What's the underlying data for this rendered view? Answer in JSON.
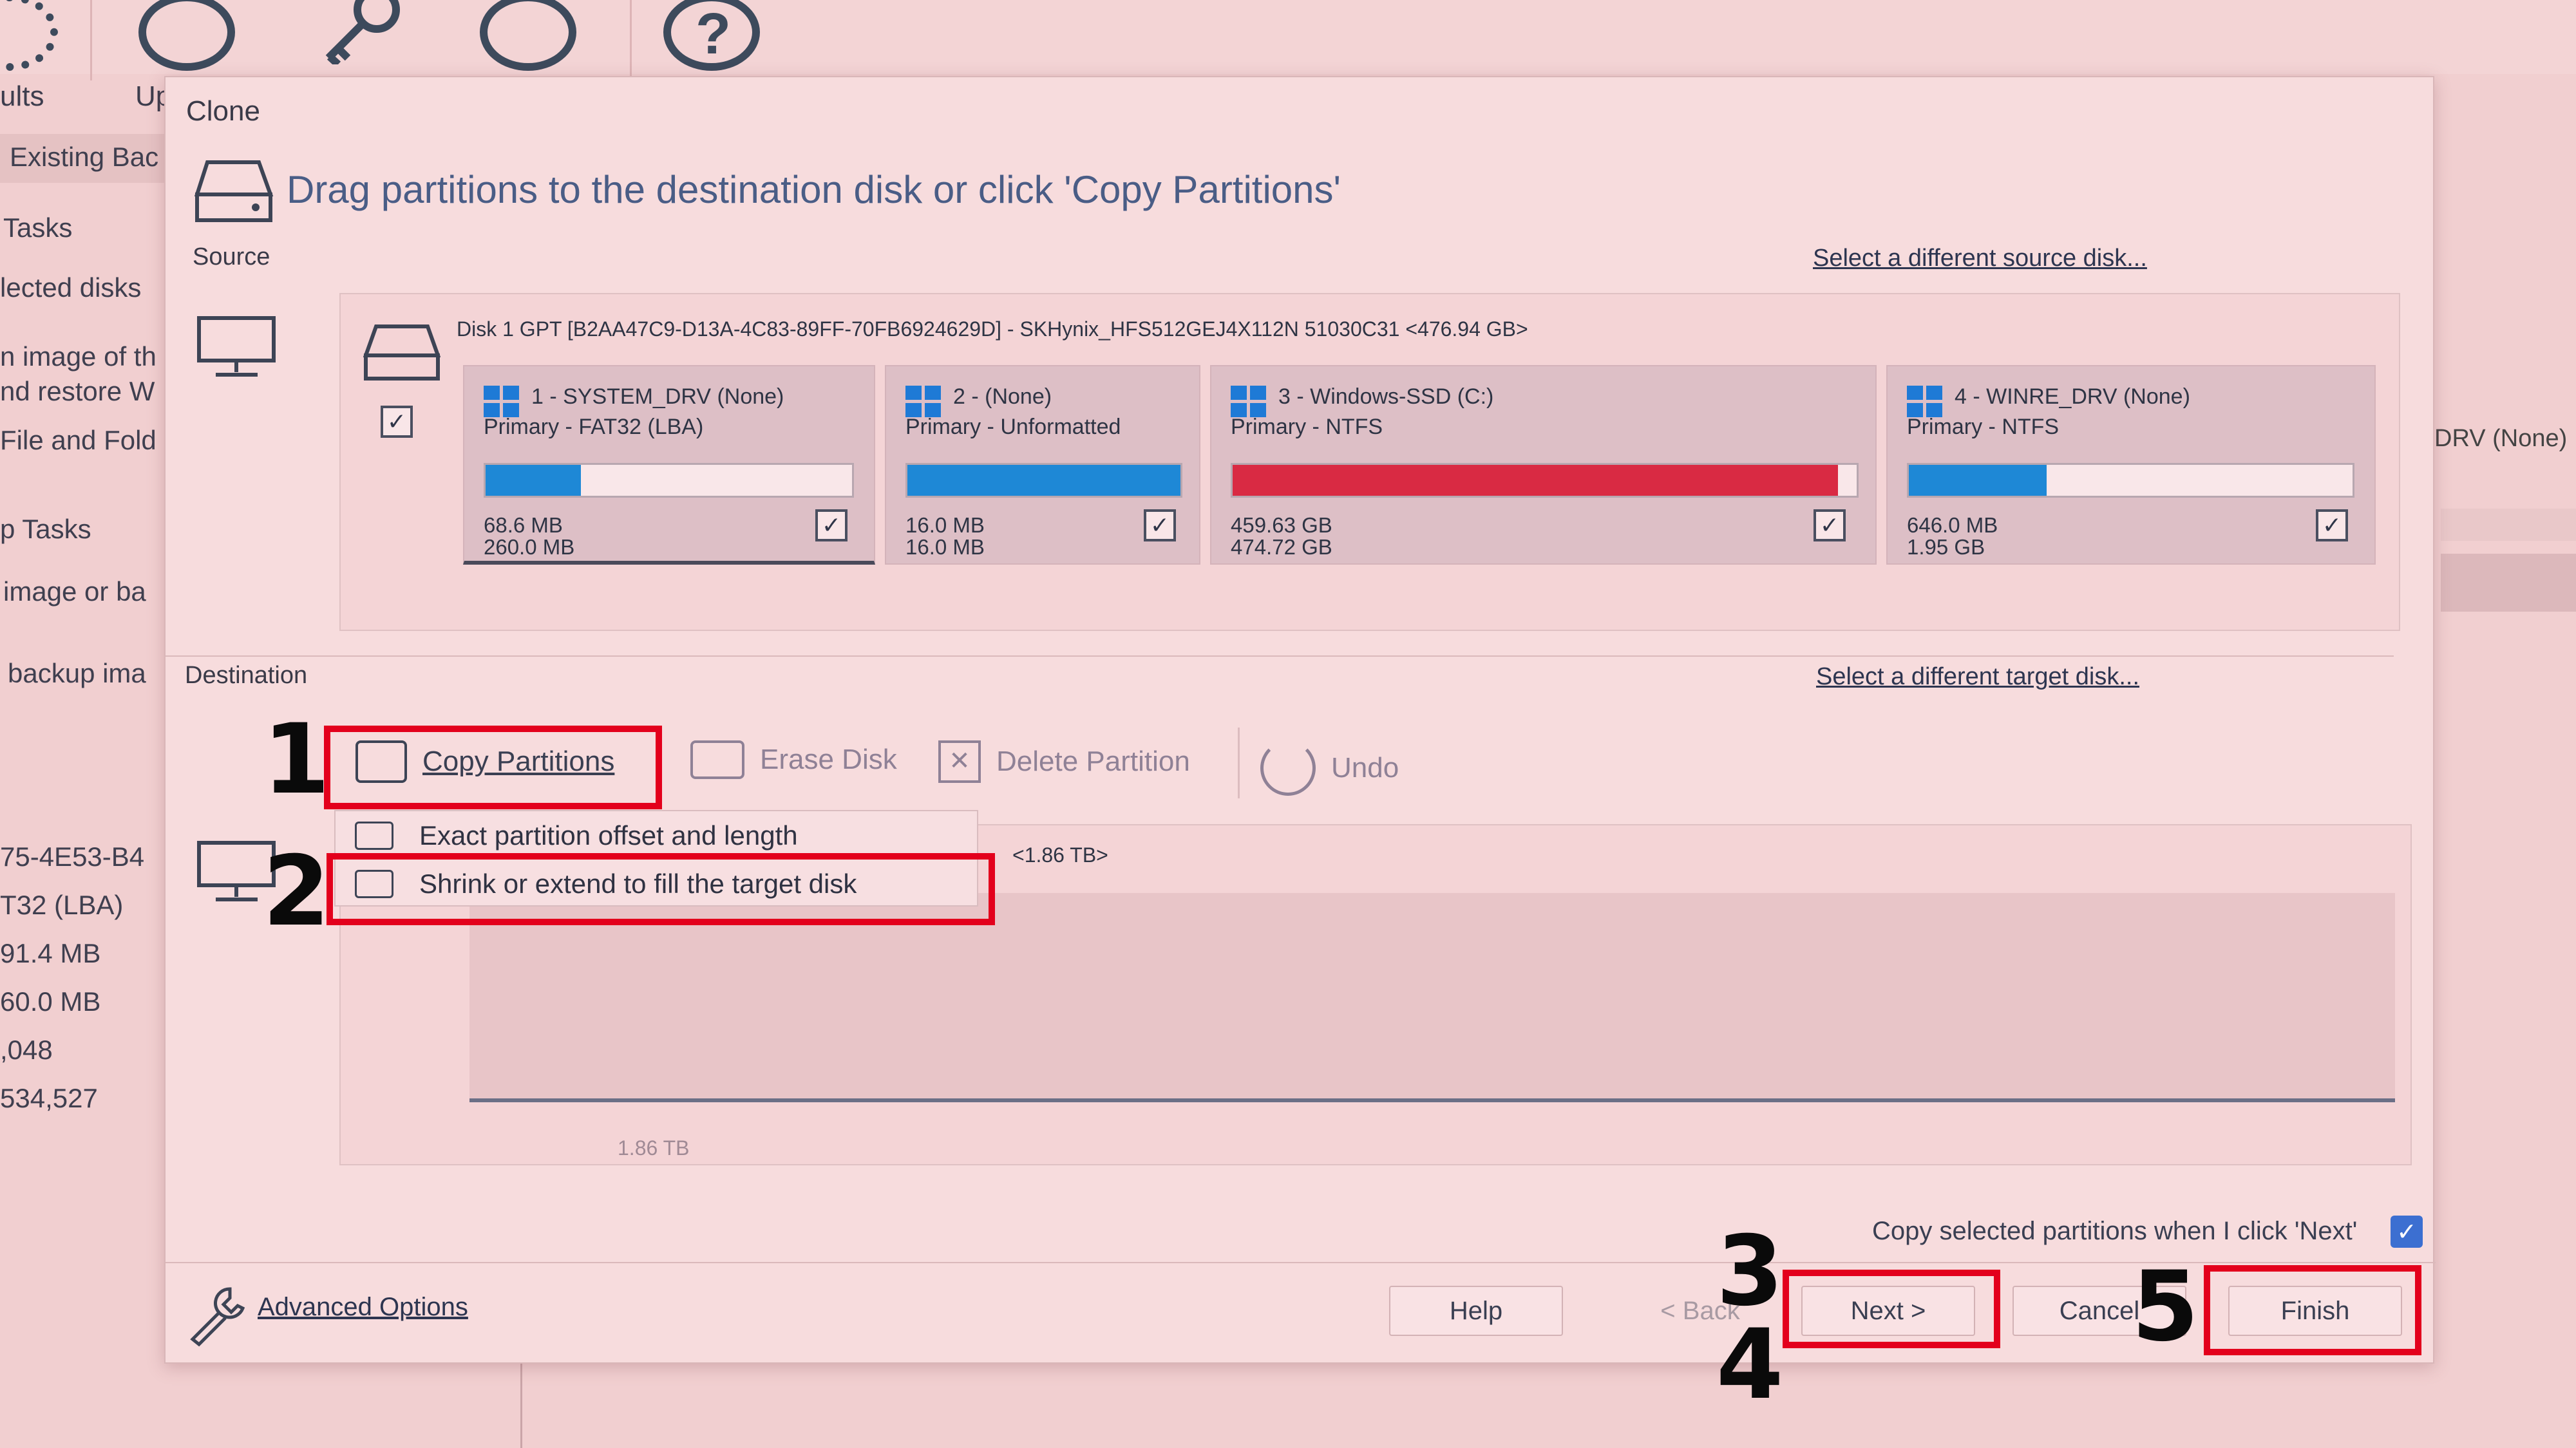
{
  "background": {
    "toolbar_labels": [
      "ults",
      "Up"
    ],
    "sidebar": [
      "Existing Bac",
      "Tasks",
      "lected disks",
      "n image of th",
      "nd restore W",
      "File and Fold",
      "p Tasks",
      "image or ba",
      "backup ima"
    ],
    "details": [
      "75-4E53-B4",
      "T32 (LBA)",
      "91.4 MB",
      "60.0 MB",
      ",048",
      "534,527"
    ],
    "right_partition": "DRV (None)"
  },
  "dialog": {
    "title": "Clone",
    "heading": "Drag partitions to the destination disk or click 'Copy Partitions'",
    "source_label": "Source",
    "select_source_link": "Select a different source disk...",
    "destination_label": "Destination",
    "select_target_link": "Select a different target disk...",
    "disk_header": "Disk 1 GPT [B2AA47C9-D13A-4C83-89FF-70FB6924629D] - SKHynix_HFS512GEJ4X112N 51030C31  <476.94 GB>",
    "partitions": [
      {
        "title": "1 - SYSTEM_DRV (None)",
        "subtitle": "Primary - FAT32 (LBA)",
        "used": "68.6 MB",
        "total": "260.0 MB",
        "fill": 0.26,
        "color": "#1e88d6",
        "checked": "✓"
      },
      {
        "title": "2 -  (None)",
        "subtitle": "Primary - Unformatted",
        "used": "16.0 MB",
        "total": "16.0 MB",
        "fill": 1.0,
        "color": "#1e88d6",
        "checked": "✓"
      },
      {
        "title": "3 - Windows-SSD (C:)",
        "subtitle": "Primary - NTFS",
        "used": "459.63 GB",
        "total": "474.72 GB",
        "fill": 0.97,
        "color": "#d92a43",
        "checked": "✓"
      },
      {
        "title": "4 - WINRE_DRV (None)",
        "subtitle": "Primary - NTFS",
        "used": "646.0 MB",
        "total": "1.95 GB",
        "fill": 0.31,
        "color": "#1e88d6",
        "checked": "✓"
      }
    ],
    "disk_checked": "✓",
    "toolbar": {
      "copy_partitions": "Copy Partitions",
      "erase_disk": "Erase Disk",
      "delete_partition": "Delete Partition",
      "undo": "Undo"
    },
    "copy_menu": [
      "Exact partition offset and length",
      "Shrink or extend to fill the target disk"
    ],
    "dest_header": "<1.86 TB>",
    "dest_size": "1.86 TB",
    "copy_on_next_label": "Copy selected partitions when I click 'Next'",
    "copy_on_next_checked": "✓",
    "advanced_options": "Advanced Options",
    "buttons": {
      "help": "Help",
      "back": "< Back",
      "next": "Next >",
      "cancel": "Cancel",
      "finish": "Finish"
    }
  },
  "annotations": {
    "step1": "1",
    "step2": "2",
    "step3": "3",
    "step4": "4",
    "step5": "5"
  },
  "colors": {
    "annotation_red": "#e3001c",
    "heading_blue": "#4a5d86"
  }
}
